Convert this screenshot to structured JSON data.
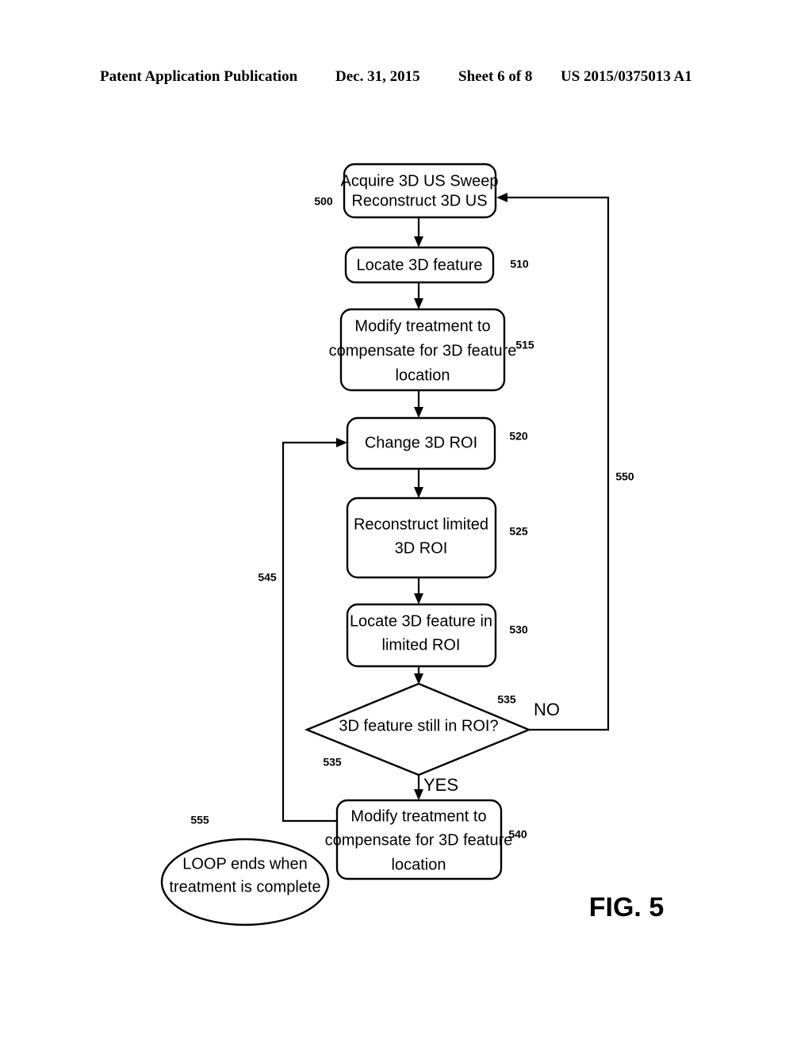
{
  "header": {
    "publication": "Patent Application Publication",
    "date": "Dec. 31, 2015",
    "sheet": "Sheet 6 of 8",
    "document_number": "US 2015/0375013 A1"
  },
  "figure": {
    "label": "FIG. 5",
    "title": "Flowchart of 3D ultrasound feature tracking treatment loop"
  },
  "nodes": {
    "n500": {
      "ref": "500",
      "shape": "rounded-rectangle",
      "line1": "Acquire 3D US Sweep",
      "line2": "Reconstruct 3D US"
    },
    "n510": {
      "ref": "510",
      "shape": "rounded-rectangle",
      "line1": "Locate 3D feature"
    },
    "n515": {
      "ref": "515",
      "shape": "rounded-rectangle",
      "line1": "Modify treatment to",
      "line2": "compensate for 3D feature",
      "line3": "location"
    },
    "n520": {
      "ref": "520",
      "shape": "rounded-rectangle",
      "line1": "Change 3D ROI"
    },
    "n525": {
      "ref": "525",
      "shape": "rounded-rectangle",
      "line1": "Reconstruct limited",
      "line2": "3D ROI"
    },
    "n530": {
      "ref": "530",
      "shape": "rounded-rectangle",
      "line1": "Locate 3D feature in",
      "line2": "limited ROI"
    },
    "n535": {
      "ref": "535",
      "ref2": "535",
      "shape": "diamond",
      "line1": "3D feature still in ROI?"
    },
    "n540": {
      "ref": "540",
      "shape": "rounded-rectangle",
      "line1": "Modify treatment to",
      "line2": "compensate for 3D feature",
      "line3": "location"
    },
    "n555": {
      "ref": "555",
      "shape": "ellipse",
      "line1": "LOOP ends when",
      "line2": "treatment is complete"
    }
  },
  "edges": {
    "yes_label": "YES",
    "no_label": "NO",
    "loop_545_ref": "545",
    "loop_550_ref": "550"
  },
  "colors": {
    "ink": "#000000",
    "paper": "#ffffff"
  }
}
